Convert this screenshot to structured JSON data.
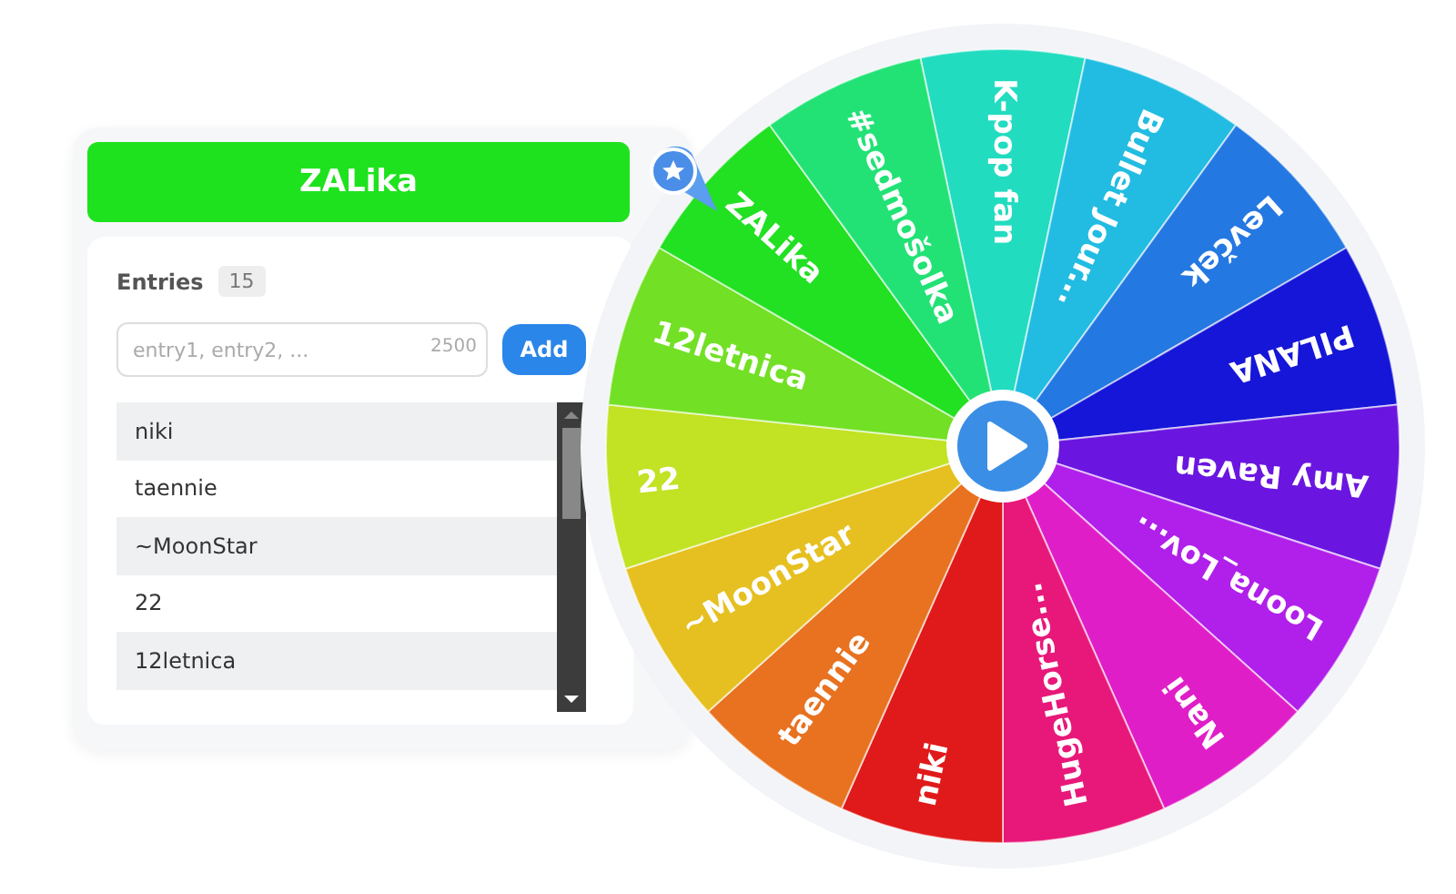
{
  "winner": {
    "label": "ZALika"
  },
  "entries": {
    "label": "Entries",
    "count": "15",
    "input": {
      "placeholder": "entry1, entry2, ...",
      "counter": "2500"
    },
    "add_button": "Add",
    "list": [
      "niki",
      "taennie",
      "~MoonStar",
      "22",
      "12letnica"
    ]
  },
  "wheel": {
    "segments": [
      {
        "label": "K-pop fan",
        "color": "#22dcc0"
      },
      {
        "label": "Bullet Jour...",
        "color": "#22bce2"
      },
      {
        "label": "Levček",
        "color": "#2478e2"
      },
      {
        "label": "PILANA",
        "color": "#1616d8"
      },
      {
        "label": "Amy Raven",
        "color": "#6a16e0"
      },
      {
        "label": "Loona_Lov...",
        "color": "#b020ea"
      },
      {
        "label": "Nani",
        "color": "#e01ec8"
      },
      {
        "label": "HugeHorse...",
        "color": "#e8187a"
      },
      {
        "label": "niki",
        "color": "#e01a1a"
      },
      {
        "label": "taennie",
        "color": "#e87220"
      },
      {
        "label": "~MoonStar",
        "color": "#e6c020"
      },
      {
        "label": "22",
        "color": "#c2e224"
      },
      {
        "label": "12letnica",
        "color": "#72e024"
      },
      {
        "label": "ZALika",
        "color": "#22e022"
      },
      {
        "label": "#sedmošolka",
        "color": "#22e276"
      }
    ]
  }
}
